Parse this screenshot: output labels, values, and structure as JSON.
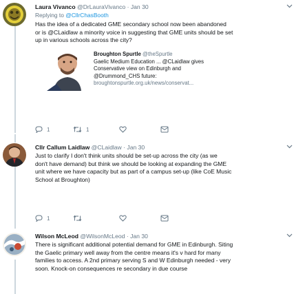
{
  "tweets": [
    {
      "name": "Laura Vivanco",
      "handle": "@DrLauraVivanco",
      "time": "Jan 30",
      "reply_prefix": "Replying to ",
      "reply_to": "@CllrChasBooth",
      "lines": [
        "Has the idea of a dedicated GME secondary school now been abandoned",
        "or is @CLaidlaw a minority voice in suggesting that GME units should be set",
        "up in various schools across the city?"
      ],
      "reply_count": "1",
      "retweet_count": "1",
      "like_count": ""
    },
    {
      "name": "Cllr Callum Laidlaw",
      "handle": "@CLaidlaw",
      "time": "Jan 30",
      "lines": [
        "Just to clarify I don't think units should be set-up across the city (as we",
        "don't have demand) but think we should be looking at expanding the GME",
        "unit where we have capacity but as part of a campus set-up (like CoE Music",
        "School at Broughton)"
      ],
      "reply_count": "1",
      "retweet_count": "",
      "like_count": ""
    },
    {
      "name": "Wilson McLeod",
      "handle": "@WilsonMcLeod",
      "time": "Jan 30",
      "lines": [
        "There is significant additional potential demand for GME in Edinburgh. Siting",
        "the Gaelic primary well away from the centre means it's v hard for many",
        "families to access. A 2nd primary serving S and W Edinburgh needed - very",
        "soon. Knock-on consequences re secondary in due course"
      ]
    }
  ],
  "card": {
    "name": "Broughton Spurtle",
    "handle": "@theSpurtle",
    "lines": [
      "Gaelic Medium Education ... @CLaidlaw gives",
      "Conservative view on Edinburgh and",
      "@Drummond_CHS future:"
    ],
    "link": "broughtonspurtle.org.uk/news/conservat..."
  },
  "separator": "·",
  "icons": {
    "reply": "reply-icon",
    "retweet": "retweet-icon",
    "like": "heart-icon",
    "message": "envelope-icon",
    "more": "chevron-down-icon"
  },
  "colors": {
    "link_blue": "#1b95e0",
    "muted": "#657786",
    "thread_line": "#ccd6dd"
  }
}
